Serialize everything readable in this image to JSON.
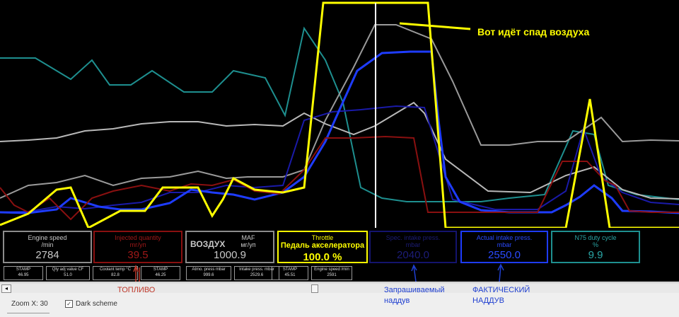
{
  "plot": {
    "annotation_text": "Вот идёт спад воздуха",
    "colors": {
      "teal": "#1e8f8f",
      "gray": "#9a9a9a",
      "gray_light": "#c8c8c8",
      "darkblue": "#1a1aa8",
      "blue": "#1e3cff",
      "red": "#8a1010",
      "yellow": "#ffff00",
      "white": "#ffffff"
    }
  },
  "gauges": [
    {
      "label": "Engine speed",
      "unit": "/min",
      "value": "2784",
      "border": "#8c8c8c",
      "label_color": "#c8c8c8",
      "value_color": "#c8c8c8",
      "overlay": ""
    },
    {
      "label": "Injected quantity",
      "unit": "mг/уп",
      "value": "39.5",
      "border": "#8a1010",
      "label_color": "#a01818",
      "value_color": "#a01818",
      "overlay": ""
    },
    {
      "label": "MAF",
      "unit": "мг/уп",
      "value": "1000.9",
      "border": "#8c8c8c",
      "label_color": "#c8c8c8",
      "value_color": "#c8c8c8",
      "overlay": "ВОЗДУХ"
    },
    {
      "label": "Throttle",
      "unit": "Педаль акселератора",
      "value": "100.0 %",
      "border": "#ffff00",
      "label_color": "#ffff00",
      "value_color": "#ffff00",
      "overlay": ""
    },
    {
      "label": "Spec. intake press.",
      "unit": "mbar",
      "value": "2040.0",
      "border": "#14146e",
      "label_color": "#1c1c78",
      "value_color": "#1c1c78",
      "overlay": ""
    },
    {
      "label": "Actual intake press.",
      "unit": "mbar",
      "value": "2550.0",
      "border": "#1e3cff",
      "label_color": "#2a4aff",
      "value_color": "#2a4aff",
      "overlay": ""
    },
    {
      "label": "N75 duty cycle",
      "unit": "%",
      "value": "9.9",
      "border": "#1e8f8f",
      "label_color": "#2aa6a6",
      "value_color": "#2aa6a6",
      "overlay": ""
    }
  ],
  "minis": [
    {
      "label": "STAMP",
      "value": "46.95"
    },
    {
      "label": "Qty adj value CF",
      "value": "51.0"
    },
    {
      "label": "Coolant temp °C",
      "value": "82.8"
    },
    {
      "label": "STAMP",
      "value": "46.25"
    },
    {
      "label": "Atmo. press mbar",
      "value": "999.6"
    },
    {
      "label": "Intake press. mbar",
      "value": "2529.6"
    },
    {
      "label": "STAMP",
      "value": "45.51"
    },
    {
      "label": "Engine speed /min",
      "value": "2591"
    }
  ],
  "annotations": {
    "fuel": "ТОПЛИВО",
    "requested_boost_1": "Запрашиваемый",
    "requested_boost_2": "наддув",
    "actual_boost_1": "ФАКТИЧЕСКИЙ",
    "actual_boost_2": "НАДДУВ",
    "fuel_color": "#c0392b",
    "boost_color": "#1f3fd0"
  },
  "scrollbar": {
    "left_arrow": "◂"
  },
  "statusbar": {
    "zoom_label": "Zoom X: 30",
    "dark_scheme_label": "Dark scheme",
    "dark_scheme_checked": "✓"
  }
}
